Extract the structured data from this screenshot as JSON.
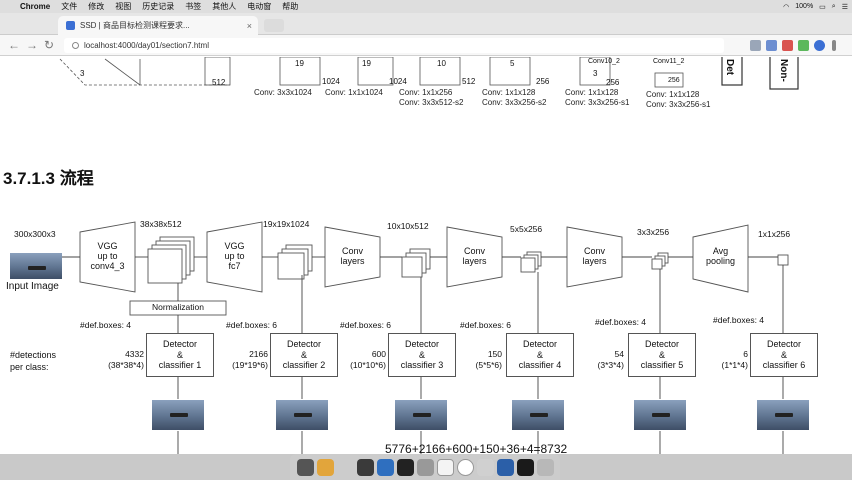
{
  "menubar": {
    "app": "Chrome",
    "items": [
      "文件",
      "修改",
      "视图",
      "历史记录",
      "书签",
      "其他人",
      "电动窗",
      "帮助"
    ],
    "battery": "100%"
  },
  "tab": {
    "title": "SSD | 商品目标检测课程要求..."
  },
  "address": {
    "url": "localhost:4000/day01/section7.html"
  },
  "top_strip": {
    "convs": [
      "Conv: 3x3x1024",
      "Conv: 1x1x1024",
      "Conv: 1x1x256",
      "Conv: 3x3x512-s2",
      "Conv: 1x1x128",
      "Conv: 3x3x256-s2",
      "Conv: 1x1x128",
      "Conv: 3x3x256-s1",
      "Conv: 1x1x128",
      "Conv: 3x3x256-s1"
    ],
    "dims": [
      "3",
      "512",
      "19",
      "1024",
      "19",
      "1024",
      "10",
      "512",
      "5",
      "256",
      "3",
      "256",
      "Conv10_2",
      "Conv11_2",
      "256"
    ],
    "side_a": "Det",
    "side_b": "Non-"
  },
  "heading": "3.7.1.3 流程",
  "pipeline": {
    "input_dim": "300x300x3",
    "input_label": "Input Image",
    "stages": [
      {
        "dim": "38x38x512",
        "block": [
          "VGG",
          "up to",
          "conv4_3"
        ]
      },
      {
        "dim": "19x19x1024",
        "block": [
          "VGG",
          "up to",
          "fc7"
        ]
      },
      {
        "dim": "10x10x512",
        "block": [
          "Conv",
          "layers"
        ]
      },
      {
        "dim": "5x5x256",
        "block": [
          "Conv",
          "layers"
        ]
      },
      {
        "dim": "3x3x256",
        "block": [
          "Conv",
          "layers"
        ]
      },
      {
        "dim": "1x1x256",
        "block": [
          "Avg",
          "pooling"
        ]
      }
    ],
    "normalization": "Normalization",
    "row_label": [
      "#detections",
      "per class:"
    ],
    "detectors": [
      {
        "boxes": "#def.boxes: 4",
        "count": "4332",
        "calc": "(38*38*4)",
        "name": [
          "Detector",
          "&",
          "classifier 1"
        ]
      },
      {
        "boxes": "#def.boxes: 6",
        "count": "2166",
        "calc": "(19*19*6)",
        "name": [
          "Detector",
          "&",
          "classifier 2"
        ]
      },
      {
        "boxes": "#def.boxes: 6",
        "count": "600",
        "calc": "(10*10*6)",
        "name": [
          "Detector",
          "&",
          "classifier 3"
        ]
      },
      {
        "boxes": "#def.boxes: 6",
        "count": "150",
        "calc": "(5*5*6)",
        "name": [
          "Detector",
          "&",
          "classifier 4"
        ]
      },
      {
        "boxes": "#def.boxes: 4",
        "count": "54",
        "calc": "(3*3*4)",
        "name": [
          "Detector",
          "&",
          "classifier 5"
        ]
      },
      {
        "boxes": "#def.boxes: 4",
        "count": "6",
        "calc": "(1*1*4)",
        "name": [
          "Detector",
          "&",
          "classifier 6"
        ]
      }
    ],
    "formula": "5776+2166+600+150+36+4=8732"
  }
}
